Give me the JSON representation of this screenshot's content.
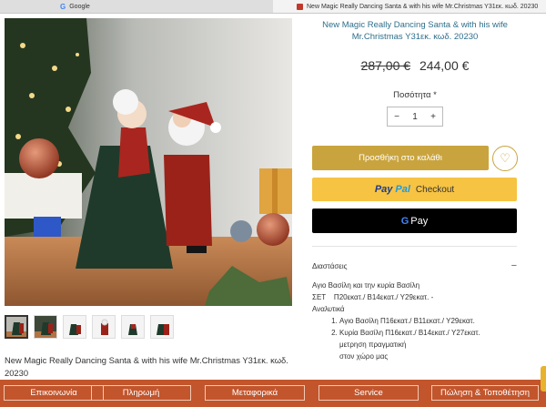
{
  "browser": {
    "tabs": [
      {
        "label": "Google"
      },
      {
        "label": "New Magic Really Dancing Santa & with his wife Mr.Christmas Y31εκ. κωδ. 20230"
      }
    ]
  },
  "product": {
    "title": "New Magic Really Dancing Santa & with his wife Mr.Christmas Y31εκ. κωδ. 20230",
    "old_price": "287,00 €",
    "new_price": "244,00 €",
    "quantity_label": "Ποσότητα *",
    "quantity": "1",
    "minus_symbol": "−",
    "plus_symbol": "+",
    "add_to_cart": "Προσθήκη στο καλάθι",
    "paypal_part1": "Pay",
    "paypal_part2": "Pal",
    "paypal_checkout": "Checkout",
    "gpay_g": "G",
    "gpay_text": "Pay",
    "bottom_title": "New Magic Really Dancing Santa & with his wife  Mr.Christmas  Y31εκ. κωδ. 20230"
  },
  "details": {
    "heading": "Διαστάσεις",
    "collapse_symbol": "−",
    "line1": "Αγιο Βασίλη και την κυρία Βασίλη",
    "line2": "ΣΕΤ    Π20εκατ./ Β14εκατ./ Y29εκατ. -",
    "line3": "Αναλυτικά",
    "items": [
      "Αγιο Βασίλη Π16εκατ./ Β11εκατ./ Y29εκατ.",
      "Κυρία Βασίλη Π16εκατ./ Β14εκατ./ Y27εκατ."
    ],
    "extra1": "μετρηση πραγματική",
    "extra2": "στον χώρο μας"
  },
  "footer": {
    "items": [
      "Επικοινωνία",
      "Πληρωμή",
      "Μεταφορικά",
      "Service",
      "Πώληση & Τοποθέτηση"
    ]
  },
  "colors": {
    "accent_gold": "#c9a43e",
    "paypal_yellow": "#f6c343",
    "footer_orange": "#c2552c",
    "title_blue": "#2e6f8c"
  },
  "thumbnails_count": 6,
  "icons": [
    "google-icon",
    "site-favicon",
    "heart-icon",
    "minus-icon",
    "plus-icon"
  ]
}
